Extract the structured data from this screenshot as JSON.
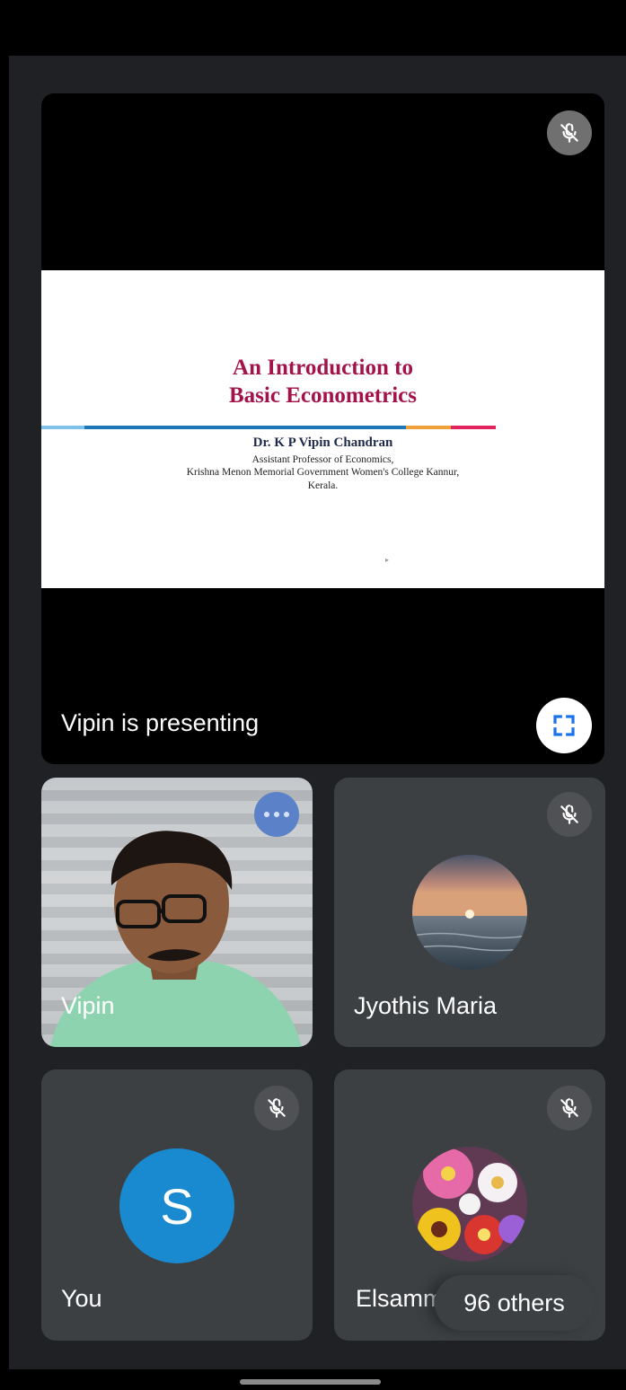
{
  "presentation": {
    "presenter_label": "Vipin is presenting",
    "slide": {
      "title_line1": "An Introduction to",
      "title_line2": "Basic Econometrics",
      "author": "Dr. K P Vipin Chandran",
      "affiliation_line1": "Assistant Professor of Economics,",
      "affiliation_line2": "Krishna Menon Memorial Government Women's College Kannur,",
      "affiliation_line3": "Kerala."
    },
    "rule_colors": [
      "#7fc1e8",
      "#1c78b6",
      "#f0a23a",
      "#e0245e"
    ]
  },
  "participants": [
    {
      "name": "Vipin",
      "muted": false,
      "has_video": true
    },
    {
      "name": "Jyothis Maria",
      "muted": true,
      "has_video": false
    },
    {
      "name": "You",
      "muted": true,
      "has_video": false,
      "avatar_letter": "S"
    },
    {
      "name": "Elsamm",
      "muted": true,
      "has_video": false
    }
  ],
  "others_label": "96 others",
  "icons": {
    "mute": "mic-off-icon",
    "fullscreen": "fullscreen-icon",
    "more": "more-options-icon"
  },
  "colors": {
    "background": "#202124",
    "tile": "#3c4043",
    "slide_title": "#a3134a",
    "avatar_you": "#1a8ad0"
  }
}
